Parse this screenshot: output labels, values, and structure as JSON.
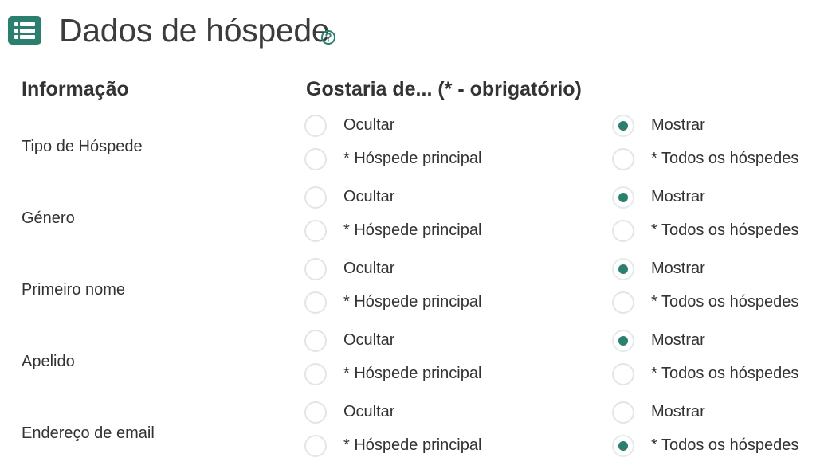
{
  "header": {
    "title": "Dados de hóspede",
    "icon": "list-icon",
    "help_icon": "help-icon"
  },
  "columns": {
    "info": "Informação",
    "pref": "Gostaria de... (* - obrigatório)"
  },
  "accent_color": "#2a7f6f",
  "rows": [
    {
      "label": "Tipo de Hóspede",
      "options": {
        "hide": "Ocultar",
        "show": "Mostrar",
        "main": "* Hóspede principal",
        "all": "* Todos os hóspedes"
      },
      "selected": "show"
    },
    {
      "label": "Género",
      "options": {
        "hide": "Ocultar",
        "show": "Mostrar",
        "main": "* Hóspede principal",
        "all": "* Todos os hóspedes"
      },
      "selected": "show"
    },
    {
      "label": "Primeiro nome",
      "options": {
        "hide": "Ocultar",
        "show": "Mostrar",
        "main": "* Hóspede principal",
        "all": "* Todos os hóspedes"
      },
      "selected": "show"
    },
    {
      "label": "Apelido",
      "options": {
        "hide": "Ocultar",
        "show": "Mostrar",
        "main": "* Hóspede principal",
        "all": "* Todos os hóspedes"
      },
      "selected": "show"
    },
    {
      "label": "Endereço de email",
      "options": {
        "hide": "Ocultar",
        "show": "Mostrar",
        "main": "* Hóspede principal",
        "all": "* Todos os hóspedes"
      },
      "selected": "all"
    }
  ]
}
